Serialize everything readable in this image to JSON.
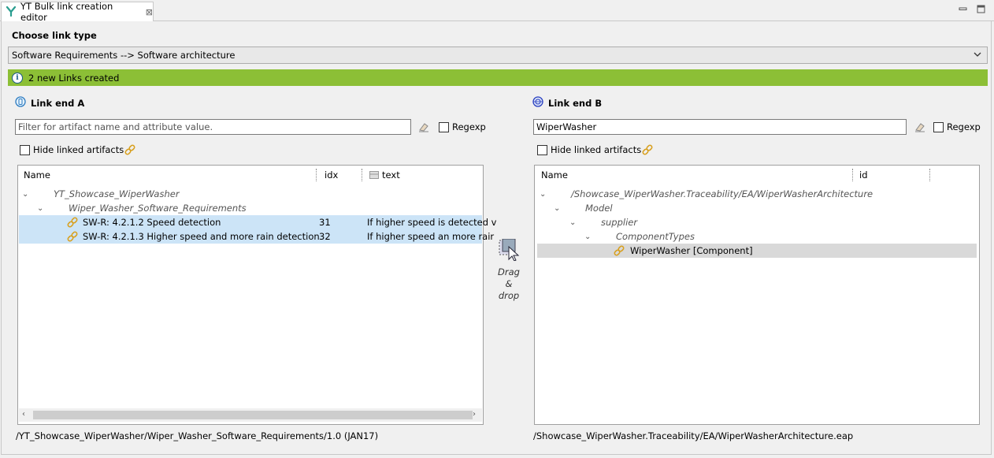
{
  "tab": {
    "title": "YT Bulk link creation editor",
    "close": "⊠"
  },
  "choose_link_type": {
    "label": "Choose link type",
    "selected": "Software Requirements --> Software architecture"
  },
  "info": {
    "message": "2 new Links created"
  },
  "end_a": {
    "label": "Link end A",
    "filter_placeholder": "Filter for artifact name and attribute value.",
    "filter_value": "",
    "regexp_label": "Regexp",
    "hide_linked_label": "Hide linked artifacts",
    "columns": [
      "Name",
      "idx",
      "text"
    ],
    "rows": [
      {
        "name": "YT_Showcase_WiperWasher",
        "level": 0,
        "italic": true
      },
      {
        "name": "Wiper_Washer_Software_Requirements",
        "level": 1,
        "italic": true
      },
      {
        "name": "SW-R: 4.2.1.2 Speed detection",
        "idx": "31",
        "text": "If higher speed is detected v",
        "level": 2,
        "selected": true
      },
      {
        "name": "SW-R: 4.2.1.3 Higher speed and more rain detection",
        "idx": "32",
        "text": "If higher speed an more rair",
        "level": 2,
        "selected": true
      }
    ],
    "path": "/YT_Showcase_WiperWasher/Wiper_Washer_Software_Requirements/1.0 (JAN17)"
  },
  "drag_drop": {
    "line1": "Drag",
    "line2": "&",
    "line3": "drop"
  },
  "end_b": {
    "label": "Link end B",
    "filter_value": "WiperWasher",
    "regexp_label": "Regexp",
    "hide_linked_label": "Hide linked artifacts",
    "columns": [
      "Name",
      "id"
    ],
    "rows": [
      {
        "name": "/Showcase_WiperWasher.Traceability/EA/WiperWasherArchitecture",
        "level": 0,
        "italic": true
      },
      {
        "name": "Model",
        "level": 1,
        "italic": true
      },
      {
        "name": "supplier",
        "level": 2,
        "italic": true
      },
      {
        "name": "ComponentTypes",
        "level": 3,
        "italic": true
      },
      {
        "name": "WiperWasher [Component]",
        "level": 4,
        "selected": true
      }
    ],
    "path": "/Showcase_WiperWasher.Traceability/EA/WiperWasherArchitecture.eap"
  },
  "colors": {
    "info_green": "#8cbf36",
    "selection_blue": "#cce4f7",
    "selection_grey": "#d9d9d9"
  }
}
